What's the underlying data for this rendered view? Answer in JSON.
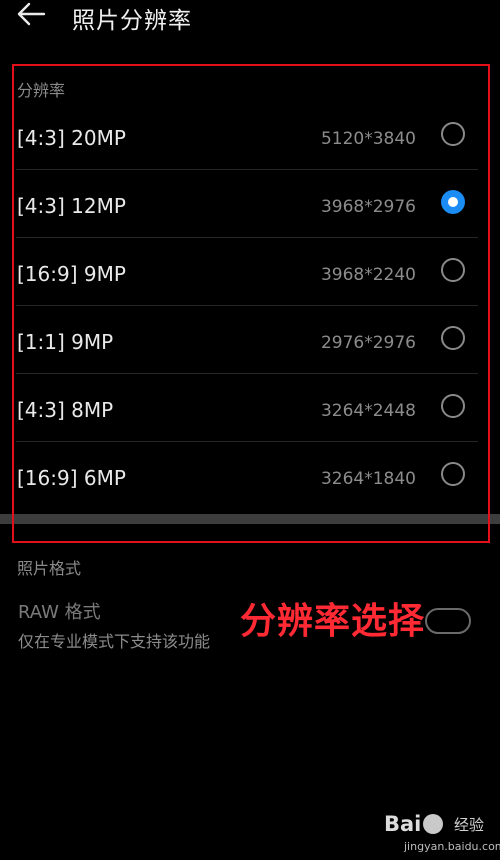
{
  "header": {
    "title": "照片分辨率"
  },
  "resolution_section": {
    "label": "分辨率",
    "options": [
      {
        "name": "[4:3] 20MP",
        "dims": "5120*3840",
        "selected": false
      },
      {
        "name": "[4:3] 12MP",
        "dims": "3968*2976",
        "selected": true
      },
      {
        "name": "[16:9] 9MP",
        "dims": "3968*2240",
        "selected": false
      },
      {
        "name": "[1:1] 9MP",
        "dims": "2976*2976",
        "selected": false
      },
      {
        "name": "[4:3] 8MP",
        "dims": "3264*2448",
        "selected": false
      },
      {
        "name": "[16:9] 6MP",
        "dims": "3264*1840",
        "selected": false
      }
    ]
  },
  "format_section": {
    "label": "照片格式",
    "raw": {
      "title": "RAW 格式",
      "subtitle": "仅在专业模式下支持该功能",
      "enabled": false
    }
  },
  "annotation": {
    "text": "分辨率选择",
    "color": "#e3101c"
  },
  "watermark": {
    "logo": "Bai",
    "logo_suffix": "经验",
    "url": "jingyan.baidu.com"
  },
  "colors": {
    "accent": "#1b8cf4",
    "background": "#000000"
  }
}
